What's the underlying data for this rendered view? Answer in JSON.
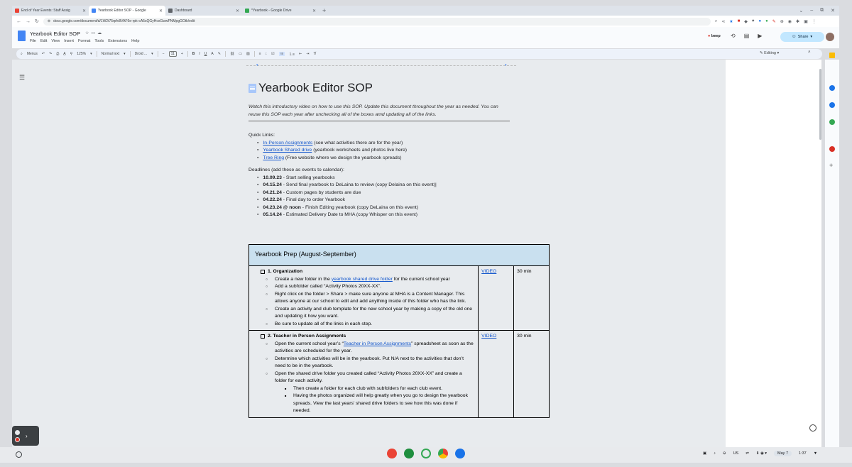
{
  "browser": {
    "tabs": [
      {
        "title": "End of Year Events: Staff Assig",
        "favicon_color": "#ea4335"
      },
      {
        "title": "Yearbook Editor SOP - Google",
        "favicon_color": "#4285f4"
      },
      {
        "title": "Dashboard",
        "favicon_color": "#5f6368"
      },
      {
        "title": "*Yearbook - Google Drive",
        "favicon_color": "#34a853"
      }
    ],
    "url": "docs.google.com/document/d/1W2t75rpfv8VAF6e-rpk-cA5sQGyHcxGwwPNMpgGOtk/edit"
  },
  "docs": {
    "title": "Yearbook Editor SOP",
    "menu": [
      "File",
      "Edit",
      "View",
      "Insert",
      "Format",
      "Tools",
      "Extensions",
      "Help"
    ],
    "beep": "beep",
    "share_label": "Share",
    "editing_label": "Editing"
  },
  "toolbar": {
    "menus_label": "Menus",
    "zoom": "125%",
    "style": "Normal text",
    "font": "Droid ...",
    "font_size": "11"
  },
  "document": {
    "title": "Yearbook Editor SOP",
    "intro": "Watch this introductory video on how to use this SOP. Update this document throughout the year as needed. You can reuse this SOP each year after unchecking all of the boxes amd updating all of the links.",
    "quick_links_label": "Quick Links:",
    "quick_links": [
      {
        "link": "In-Person Assignments",
        "desc": " (see what activities there are for the year)"
      },
      {
        "link": "Yearbook Shared drive",
        "desc": " (yearbook worksheets and photos live here)"
      },
      {
        "link": "Tree Ring",
        "desc": " (Free website where we design the yearbook spreads)"
      }
    ],
    "deadlines_label": "Deadlines (add these as events to calendar):",
    "deadlines": [
      {
        "date": "10.09.23",
        "desc": " - Start selling yearbooks"
      },
      {
        "date": "04.15.24",
        "desc": " - Send final yearbook to DeLaina to review (copy Delaina on this event)"
      },
      {
        "date": "04.21.24",
        "desc": " - Custom pages by students are due"
      },
      {
        "date": "04.22.24",
        "desc": " - Final day to order Yearbook"
      },
      {
        "date": "04.23.24 @ noon",
        "desc": " - Finish Editing yearbook (copy DeLaina on this event)"
      },
      {
        "date": "05.14.24",
        "desc": " - Estimated Delivery Date to MHA (copy Whisper on this event)"
      }
    ],
    "table": {
      "header": "Yearbook Prep (August-September)",
      "steps": [
        {
          "title": "1. Organization",
          "video": "VIDEO",
          "time": "30 min",
          "items": [
            {
              "pre": "Create a new folder in the ",
              "link": "yearbook shared drive folder",
              "post": " for the current school year"
            },
            {
              "pre": "Add a subfolder called “Activity Photos 20XX-XX”.",
              "link": "",
              "post": ""
            },
            {
              "pre": "Right click on the folder > Share > make sure anyone at MHA is a Content Manager. This allows anyone at our school to edit and add anything inside of this folder who has the link.",
              "link": "",
              "post": ""
            },
            {
              "pre": "Create an activity and club template for the new school year by making a copy of the old one and updating it how you want.",
              "link": "",
              "post": ""
            },
            {
              "pre": "Be sure to update all of the links in each step.",
              "link": "",
              "post": ""
            }
          ]
        },
        {
          "title": "2. Teacher in Person Assignments",
          "video": "VIDEO",
          "time": "30 min",
          "items": [
            {
              "pre": "Open the current school year’s “",
              "link": "Teacher in Person Assignments",
              "post": "” spreadsheet as soon as the activities are scheduled for the year."
            },
            {
              "pre": "Determine which activities will be in the yearbook. Put N/A next to the activities that don’t need to be in the yearbook.",
              "link": "",
              "post": ""
            },
            {
              "pre": "Open the shared drive folder you created called “Activity Photos 20XX-XX” and create a folder for each activity.",
              "link": "",
              "post": ""
            }
          ],
          "subitems": [
            "Then create a folder for each club with subfolders for each club event.",
            "Having the photos organized will help greatly when you go to design the yearbook spreads. View the last years’ shared drive folders to see how this was done if needed."
          ]
        }
      ]
    }
  },
  "tray": {
    "locale": "US",
    "date": "May 7",
    "time": "1:37"
  }
}
